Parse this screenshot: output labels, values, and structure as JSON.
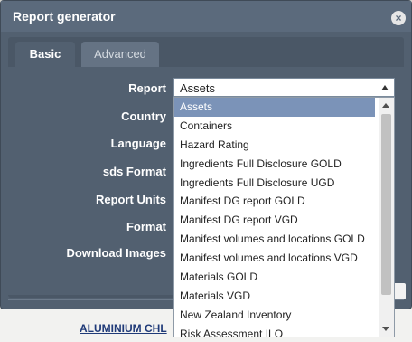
{
  "background": {
    "link": "ALUMINIUM CHL"
  },
  "dialog": {
    "title": "Report generator",
    "close_icon": "×",
    "tabs": [
      {
        "label": "Basic",
        "active": true
      },
      {
        "label": "Advanced",
        "active": false
      }
    ],
    "fields": [
      {
        "label": "Report"
      },
      {
        "label": "Country"
      },
      {
        "label": "Language"
      },
      {
        "label": "sds Format"
      },
      {
        "label": "Report Units"
      },
      {
        "label": "Format"
      },
      {
        "label": "Download Images"
      }
    ],
    "report_select": {
      "value": "Assets"
    },
    "dropdown_options": [
      "Assets",
      "Containers",
      "Hazard Rating",
      "Ingredients Full Disclosure GOLD",
      "Ingredients Full Disclosure UGD",
      "Manifest DG report GOLD",
      "Manifest DG report VGD",
      "Manifest volumes and locations GOLD",
      "Manifest volumes and locations VGD",
      "Materials GOLD",
      "Materials VGD",
      "New Zealand Inventory",
      "Risk Assessment ILO"
    ],
    "selected_option": "Assets"
  },
  "colors": {
    "dialog_bg": "#526070",
    "selected_option": "#7b93b8",
    "title_text": "#ffffff"
  }
}
